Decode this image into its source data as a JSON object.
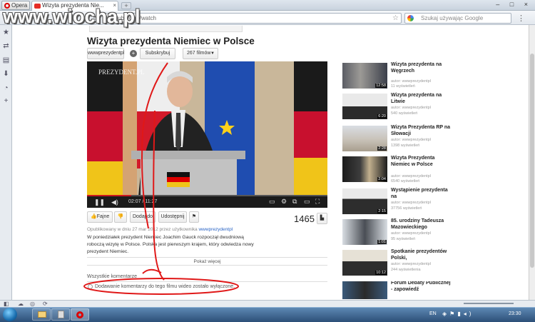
{
  "watermark": "www.wiocha.pl",
  "browser": {
    "menu_label": "Opera",
    "tab_title": "Wizyta prezydenta Nie...",
    "tab_close": "×",
    "new_tab": "+",
    "url": "youtube.com/watch",
    "search_placeholder": "Szukaj używając Google",
    "window_controls": "– □ ×"
  },
  "video": {
    "title": "Wizyta prezydenta Niemiec w Polsce",
    "channel": "wwwprezydentpl",
    "subscribe_label": "Subskrybuj",
    "videos_count_label": "267 filmów",
    "overlay_text": "PREZYDENT.PL",
    "current_time": "02:07",
    "duration": "11:27",
    "progress": 0.185,
    "views": "1465",
    "like_label": "Fajne",
    "add_label": "Dodaj do",
    "share_label": "Udostępnij",
    "published": "Opublikowany w dniu 27 mar 2012 przez użytkownika",
    "published_user": "wwwprezydentpl",
    "description": "W poniedziałek prezydent Niemiec Joachim Gauck rozpoczął dwudniową roboczą wizytę w Polsce. Polska jest pierwszym krajem, który odwiedza nowy prezydent Niemiec.",
    "show_more": "Pokaż więcej",
    "comments_header": "Wszystkie komentarze",
    "comments_disabled": "Dodawanie komentarzy do tego filmu wideo zostało wyłączone."
  },
  "related": [
    {
      "title": "Wizyta prezydenta na Węgrzech",
      "author": "autor: wwwprezydentpl",
      "views": "11 wyświetleń",
      "duration": "12:58"
    },
    {
      "title": "Wizyta prezydenta na Litwie",
      "author": "autor: wwwprezydentpl",
      "views": "540 wyświetleń",
      "duration": "6:20"
    },
    {
      "title": "Wizyta Prezydenta RP na Słowacji",
      "author": "autor: wwwprezydentpl",
      "views": "1398 wyświetleń",
      "duration": "2:28"
    },
    {
      "title": "Wizyta Prezydenta Niemiec w Polsce",
      "author": "autor: wwwprezydentpl",
      "views": "6540 wyświetleń",
      "duration": "2:04"
    },
    {
      "title": "Wystąpienie prezydenta na",
      "author": "autor: wwwprezydentpl",
      "views": "37756 wyświetleń",
      "duration": "2:15"
    },
    {
      "title": "85. urodziny Tadeusza Mazowieckiego",
      "author": "autor: wwwprezydentpl",
      "views": "95 wyświetleń",
      "duration": "1:01"
    },
    {
      "title": "Spotkanie prezydentów Polski,",
      "author": "autor: wwwprezydentpl",
      "views": "244 wyświetlenia",
      "duration": "10:12"
    },
    {
      "title": "Forum Debaty Publicznej - zapowiedź",
      "author": "",
      "views": "",
      "duration": ""
    }
  ],
  "taskbar": {
    "lang": "EN",
    "clock": "23:30"
  }
}
